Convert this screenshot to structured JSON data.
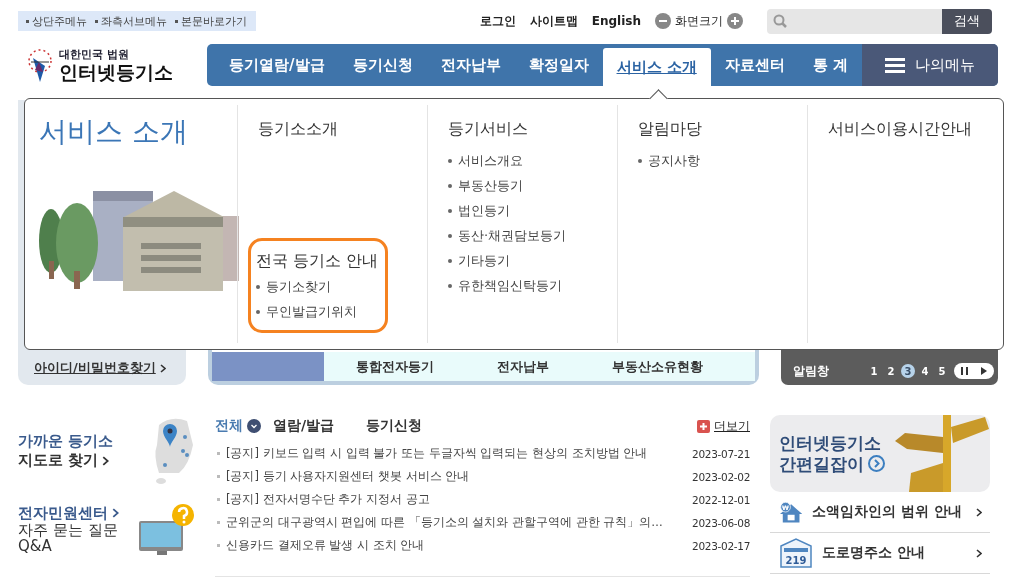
{
  "skip_links": [
    "상단주메뉴",
    "좌측서브메뉴",
    "본문바로가기"
  ],
  "utility": {
    "links": [
      "로그인",
      "사이트맵",
      "English"
    ],
    "zoom_label": "화면크기"
  },
  "search": {
    "button": "검색"
  },
  "logo": {
    "subtitle": "대한민국 법원",
    "title": "인터넷등기소"
  },
  "nav": {
    "items": [
      {
        "label": "등기열람/발급",
        "selected": false
      },
      {
        "label": "등기신청",
        "selected": false
      },
      {
        "label": "전자납부",
        "selected": false
      },
      {
        "label": "확정일자",
        "selected": false
      },
      {
        "label": "서비스 소개",
        "selected": true
      },
      {
        "label": "자료센터",
        "selected": false
      },
      {
        "label": "통 계",
        "selected": false
      }
    ],
    "my_menu": "나의메뉴"
  },
  "dropdown": {
    "title": "서비스 소개",
    "columns": [
      {
        "heading": "등기소소개",
        "highlight": {
          "heading": "전국 등기소 안내",
          "items": [
            "등기소찾기",
            "무인발급기위치"
          ]
        }
      },
      {
        "heading": "등기서비스",
        "items": [
          "서비스개요",
          "부동산등기",
          "법인등기",
          "동산·채권담보등기",
          "기타등기",
          "유한책임신탁등기"
        ]
      },
      {
        "heading": "알림마당",
        "items": [
          "공지사항"
        ]
      },
      {
        "heading": "서비스이용시간안내"
      }
    ]
  },
  "behind": {
    "login_link": "아이디/비밀번호찾기",
    "shortcuts": [
      "통합전자등기",
      "전자납부",
      "부동산소유현황"
    ],
    "notice_bar": {
      "label": "알림창",
      "pages": [
        {
          "label": "1",
          "selected": false
        },
        {
          "label": "2",
          "selected": false
        },
        {
          "label": "3",
          "selected": true
        },
        {
          "label": "4",
          "selected": false
        },
        {
          "label": "5",
          "selected": false
        }
      ]
    }
  },
  "side_links": [
    {
      "kind": "map",
      "title": "가까운 등기소",
      "subtitle": "지도로 찾기"
    },
    {
      "kind": "help",
      "title": "전자민원센터",
      "subtitle": "자주 묻는 질문",
      "extra": "Q&A"
    }
  ],
  "notices": {
    "tabs": [
      {
        "label": "전체",
        "selected": true
      },
      {
        "label": "열람/발급",
        "selected": false
      },
      {
        "label": "등기신청",
        "selected": false
      }
    ],
    "more": "더보기",
    "rows": [
      {
        "text": "[공지] 키보드 입력 시 입력 불가 또는 두글자씩 입력되는 현상의 조치방법 안내",
        "date": "2023-07-21"
      },
      {
        "text": "[공지] 등기 사용자지원센터 챗봇 서비스 안내",
        "date": "2023-02-02"
      },
      {
        "text": "[공지] 전자서명수단 추가 지정서 공고",
        "date": "2022-12-01"
      },
      {
        "text": "군위군의 대구광역시 편입에 따른 「등기소의 설치와 관할구역에 관한 규칙」의…",
        "date": "2023-06-08"
      },
      {
        "text": "신용카드 결제오류 발생 시 조치 안내",
        "date": "2023-02-17"
      }
    ]
  },
  "guide": {
    "title_lines": [
      "인터넷등기소",
      "간편길잡이"
    ],
    "links": [
      {
        "kind": "house",
        "label": "소액임차인의 범위 안내",
        "icon_text": "₩"
      },
      {
        "kind": "address",
        "label": "도로명주소 안내",
        "icon_text": "219"
      }
    ]
  }
}
